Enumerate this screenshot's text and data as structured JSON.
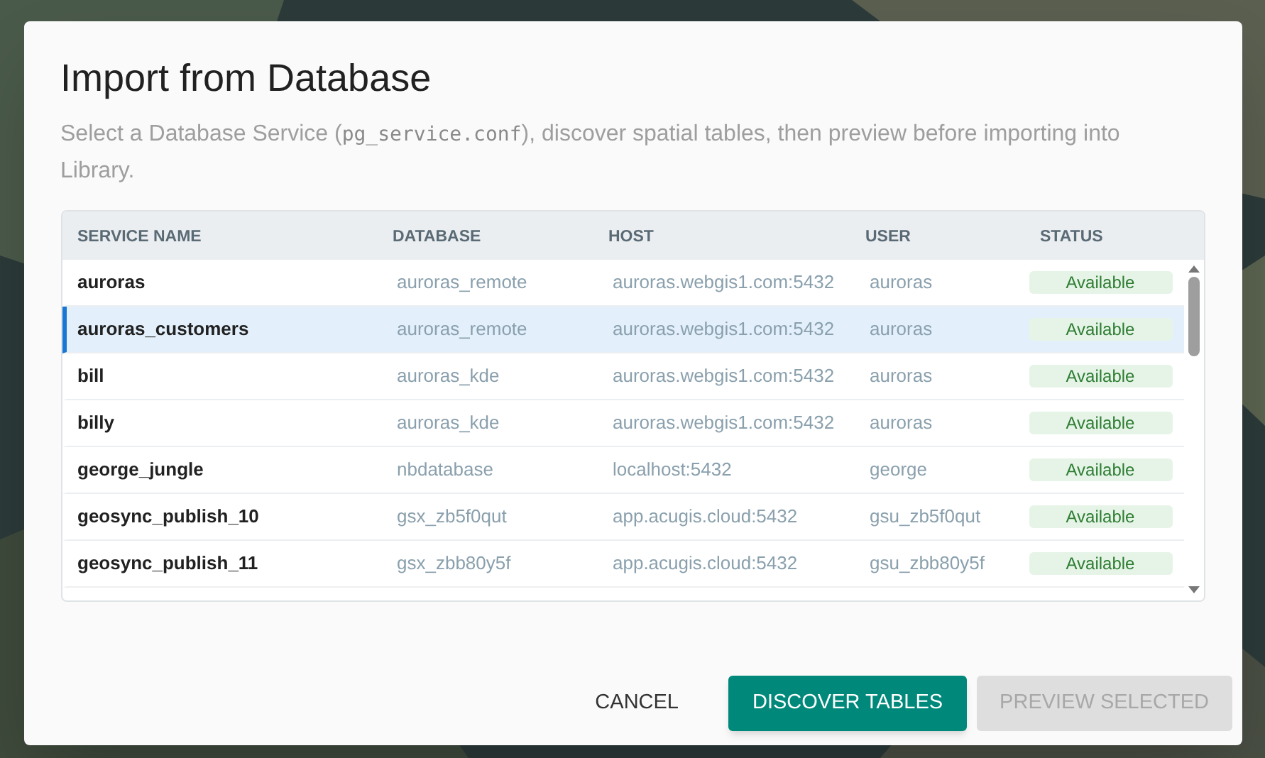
{
  "dialog": {
    "title": "Import from Database",
    "description": [
      {
        "kind": "text",
        "text": "Select a Database Service ("
      },
      {
        "kind": "code",
        "text": "pg_service.conf"
      },
      {
        "kind": "text",
        "text": "), discover spatial tables, then preview before importing into Library."
      }
    ]
  },
  "table": {
    "columns": [
      "SERVICE NAME",
      "DATABASE",
      "HOST",
      "USER",
      "STATUS"
    ],
    "rows": [
      {
        "service": "auroras",
        "database": "auroras_remote",
        "host": "auroras.webgis1.com:5432",
        "user": "auroras",
        "status": "Available",
        "selected": false
      },
      {
        "service": "auroras_customers",
        "database": "auroras_remote",
        "host": "auroras.webgis1.com:5432",
        "user": "auroras",
        "status": "Available",
        "selected": true
      },
      {
        "service": "bill",
        "database": "auroras_kde",
        "host": "auroras.webgis1.com:5432",
        "user": "auroras",
        "status": "Available",
        "selected": false
      },
      {
        "service": "billy",
        "database": "auroras_kde",
        "host": "auroras.webgis1.com:5432",
        "user": "auroras",
        "status": "Available",
        "selected": false
      },
      {
        "service": "george_jungle",
        "database": "nbdatabase",
        "host": "localhost:5432",
        "user": "george",
        "status": "Available",
        "selected": false
      },
      {
        "service": "geosync_publish_10",
        "database": "gsx_zb5f0qut",
        "host": "app.acugis.cloud:5432",
        "user": "gsu_zb5f0qut",
        "status": "Available",
        "selected": false
      },
      {
        "service": "geosync_publish_11",
        "database": "gsx_zbb80y5f",
        "host": "app.acugis.cloud:5432",
        "user": "gsu_zbb80y5f",
        "status": "Available",
        "selected": false
      }
    ]
  },
  "buttons": [
    {
      "label": "CANCEL",
      "kind": "text",
      "disabled": false
    },
    {
      "label": "DISCOVER TABLES",
      "kind": "primary",
      "disabled": false
    },
    {
      "label": "PREVIEW SELECTED",
      "kind": "primary",
      "disabled": true
    }
  ]
}
